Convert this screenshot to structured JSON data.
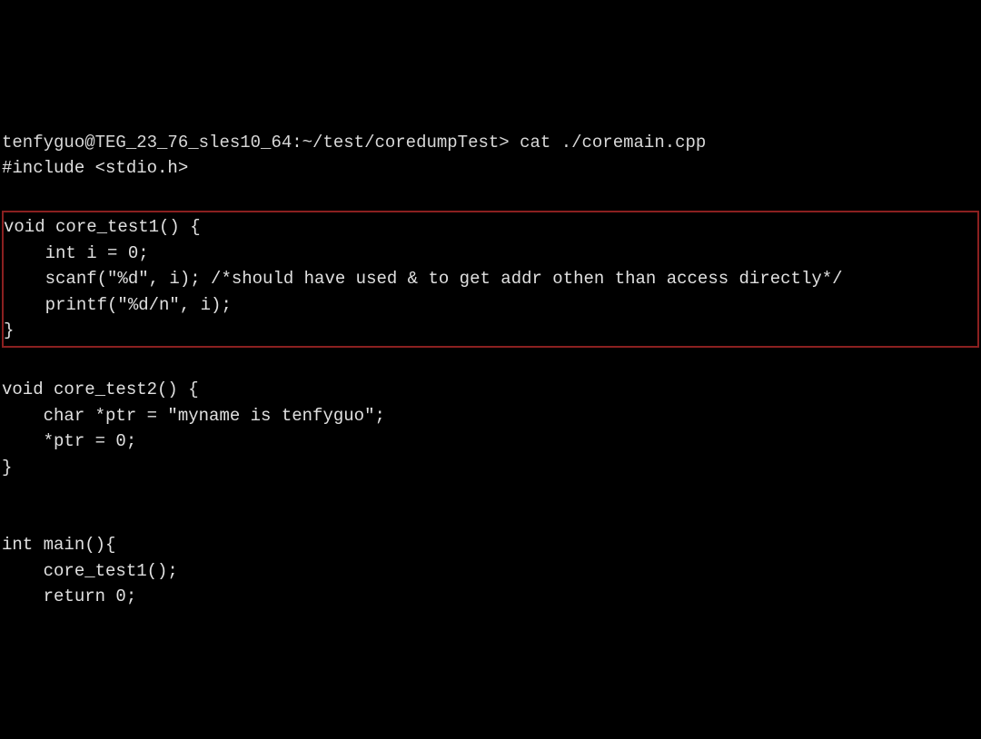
{
  "terminal": {
    "prompt": "tenfyguo@TEG_23_76_sles10_64:~/test/coredumpTest> cat ./coremain.cpp",
    "include": "#include <stdio.h>",
    "func1": {
      "signature": "void core_test1() {",
      "line1": "    int i = 0;",
      "line2": "    scanf(\"%d\", i); /*should have used & to get addr othen than access directly*/",
      "line3": "    printf(\"%d/n\", i);",
      "close": "}"
    },
    "func2": {
      "signature": "void core_test2() {",
      "line1": "    char *ptr = \"myname is tenfyguo\";",
      "line2": "    *ptr = 0;",
      "close": "}"
    },
    "main": {
      "signature": "int main(){",
      "line1": "    core_test1();",
      "line2": "    return 0;",
      "close": "}"
    }
  }
}
